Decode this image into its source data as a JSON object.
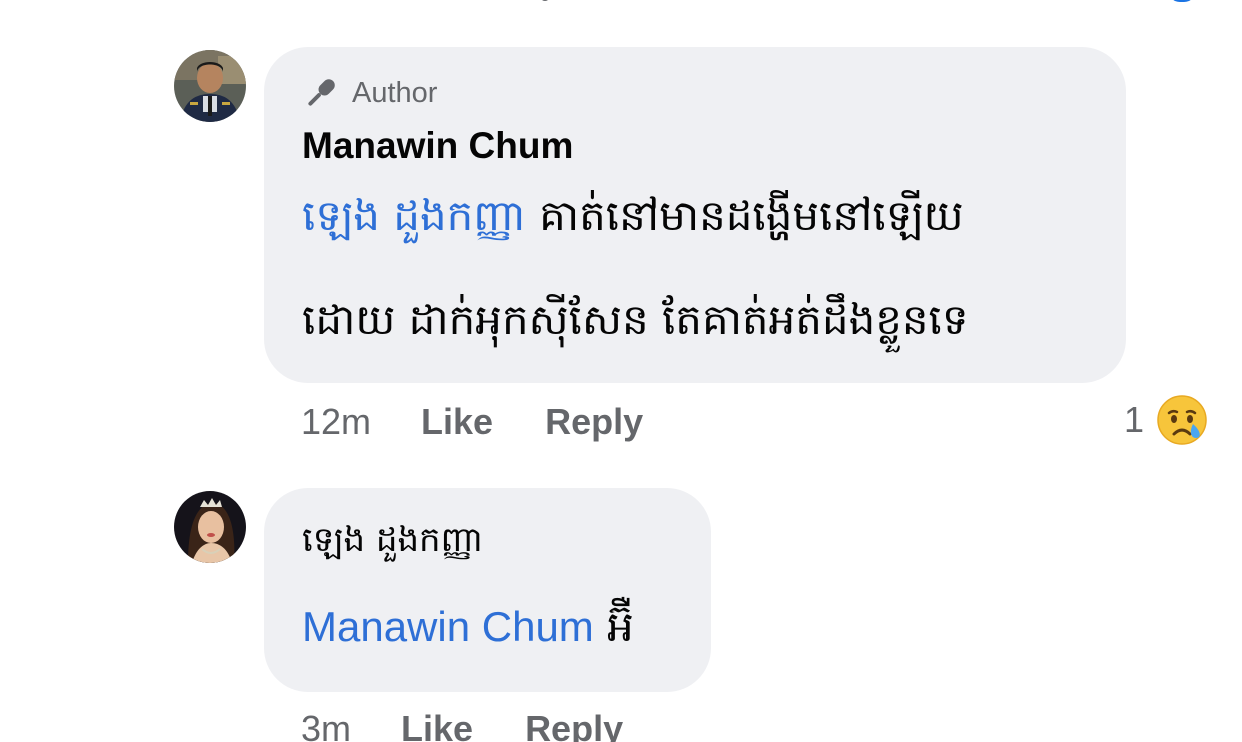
{
  "comments": [
    {
      "author_badge": "Author",
      "name": "Manawin Chum",
      "mention": "ឡេង ដួងកញ្ញា",
      "line1": "គាត់នៅមានដង្ហើមនៅឡើយ",
      "line2": "ដោយ ដាក់អុកស៊ីសែន តែគាត់អត់ដឹងខ្លួនទេ",
      "time": "12m",
      "like_label": "Like",
      "reply_label": "Reply",
      "reaction_count": "1",
      "reaction_icon": "crying-face-emoji"
    },
    {
      "name": "ឡេង ដួងកញ្ញា",
      "mention": "Manawin Chum",
      "text": "អ៊ឺ",
      "time": "3m",
      "like_label": "Like",
      "reply_label": "Reply"
    }
  ],
  "colors": {
    "bubble": "#eff0f3",
    "mention": "#2e6fd6",
    "secondary_text": "#65676b",
    "primary_text": "#050505"
  }
}
